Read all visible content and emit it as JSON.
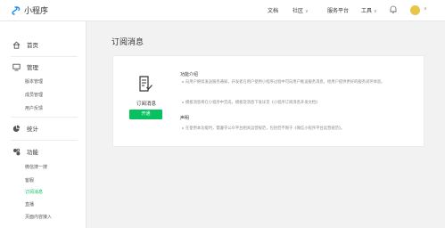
{
  "app": {
    "title": "小程序"
  },
  "topnav": {
    "items": [
      {
        "label": "文档",
        "caret": false
      },
      {
        "label": "社区",
        "caret": true
      },
      {
        "label": "服务平台",
        "caret": false
      },
      {
        "label": "工具",
        "caret": true
      }
    ]
  },
  "sidebar": {
    "sections": [
      {
        "label": "首页",
        "icon": "home-icon",
        "items": []
      },
      {
        "label": "管理",
        "icon": "monitor-icon",
        "items": [
          "版本管理",
          "成员管理",
          "用户反馈"
        ]
      },
      {
        "label": "统计",
        "icon": "pie-chart-icon",
        "items": []
      },
      {
        "label": "功能",
        "icon": "puzzle-icon",
        "items": [
          "微信搜一搜",
          "客服",
          "订阅消息",
          "直播",
          "页面内容接入"
        ],
        "active": "订阅消息"
      }
    ]
  },
  "main": {
    "title": "订阅消息",
    "card": {
      "name": "订阅消息",
      "button": "开通",
      "intro_title": "功能介绍",
      "intro_items": [
        "向用户继续发送服务通知，开发者在用户使用小程序过程中可向用户推送服务消息，给用户提供更好的服务闭环体验。",
        "模板消息将在小程序中完成，模板及消息下发详见《小程序订阅消息开发文档》"
      ],
      "notice_title": "声明",
      "notice_items": [
        "在使用本功能时，需遵守公众平台相关运营规范，包括但不限于《微信小程序平台运营规范》。"
      ]
    }
  },
  "colors": {
    "accent": "#07c160",
    "background": "#f2f2f2"
  }
}
